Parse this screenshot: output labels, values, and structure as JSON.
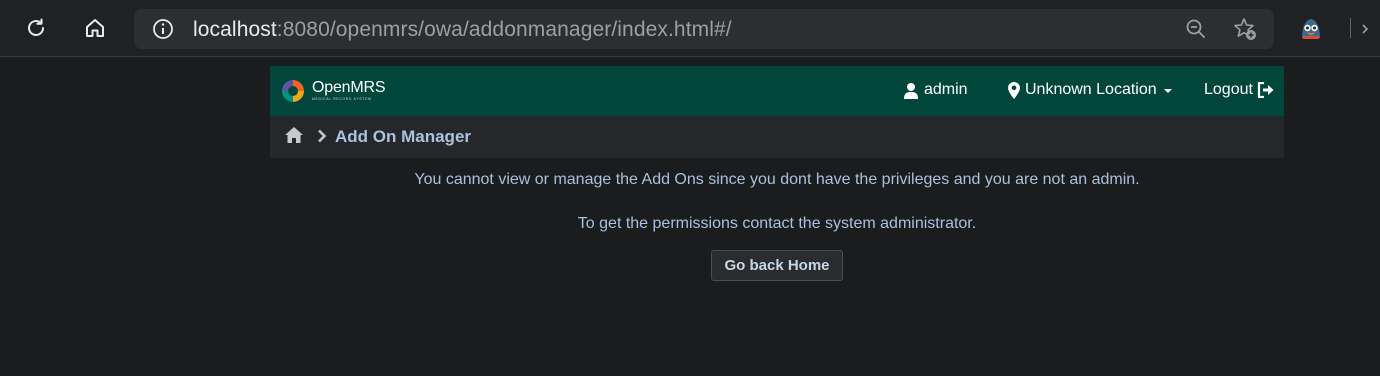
{
  "browser": {
    "url_host": "localhost",
    "url_rest": ":8080/openmrs/owa/addonmanager/index.html#/",
    "icons": [
      "reload-icon",
      "home-icon",
      "info-icon",
      "zoom-out-icon",
      "favorite-add-icon",
      "profile-avatar"
    ]
  },
  "header": {
    "logo_name": "OpenMRS",
    "logo_tagline": "MEDICAL RECORD SYSTEM",
    "user_label": "admin",
    "location_label": "Unknown Location",
    "logout_label": "Logout"
  },
  "breadcrumb": {
    "title": "Add On Manager"
  },
  "content": {
    "no_privilege_message": "You cannot view or manage the Add Ons since you dont have the privileges and you are not an admin.",
    "contact_message": "To get the permissions contact the system administrator.",
    "go_home_button": "Go back Home"
  },
  "colors": {
    "header_bg": "#00463b",
    "breadcrumb_bg": "#26272a",
    "page_bg": "#1b1c1e",
    "text_accent": "#a9c1dd"
  }
}
